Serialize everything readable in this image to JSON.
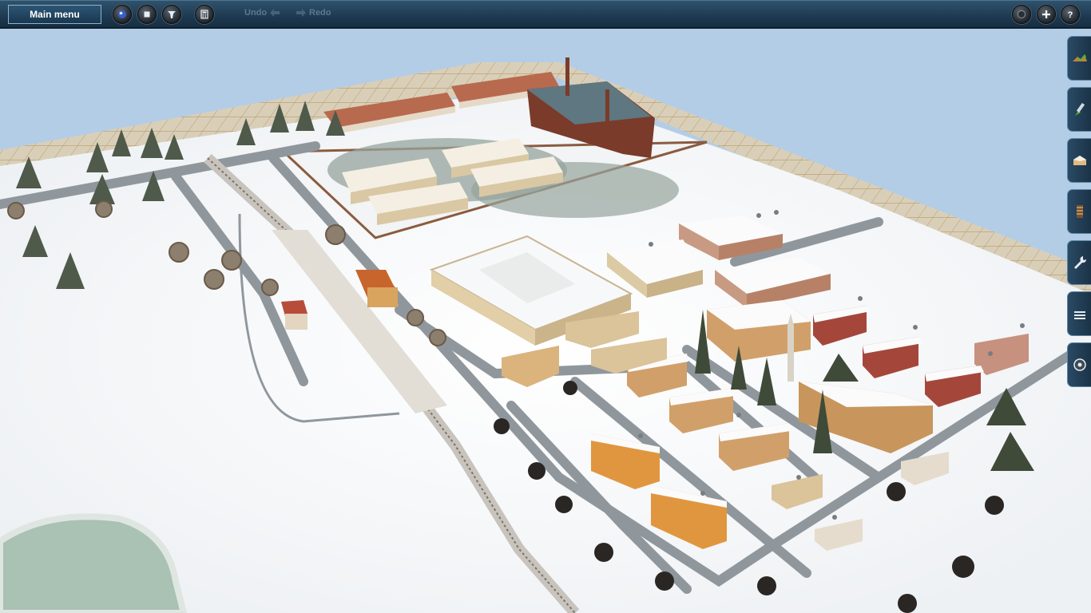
{
  "toolbar": {
    "main_menu_label": "Main menu",
    "undo_label": "Undo",
    "redo_label": "Redo",
    "left_icons": [
      "view-icon",
      "stop-icon",
      "tools-icon",
      "calculator-icon"
    ],
    "right_icons": [
      "camera-icon",
      "add-icon",
      "help-icon"
    ]
  },
  "side_tools": [
    "terrain-tool-icon",
    "paint-tool-icon",
    "buildings-tool-icon",
    "track-tool-icon",
    "wrench-tool-icon",
    "layers-tool-icon",
    "settings-tool-icon"
  ],
  "colors": {
    "toolbar": "#1d3a52",
    "sky": "#b3cde6",
    "snow": "#fbfcfd",
    "road": "#8f979d",
    "grid": "#c8b28c"
  }
}
